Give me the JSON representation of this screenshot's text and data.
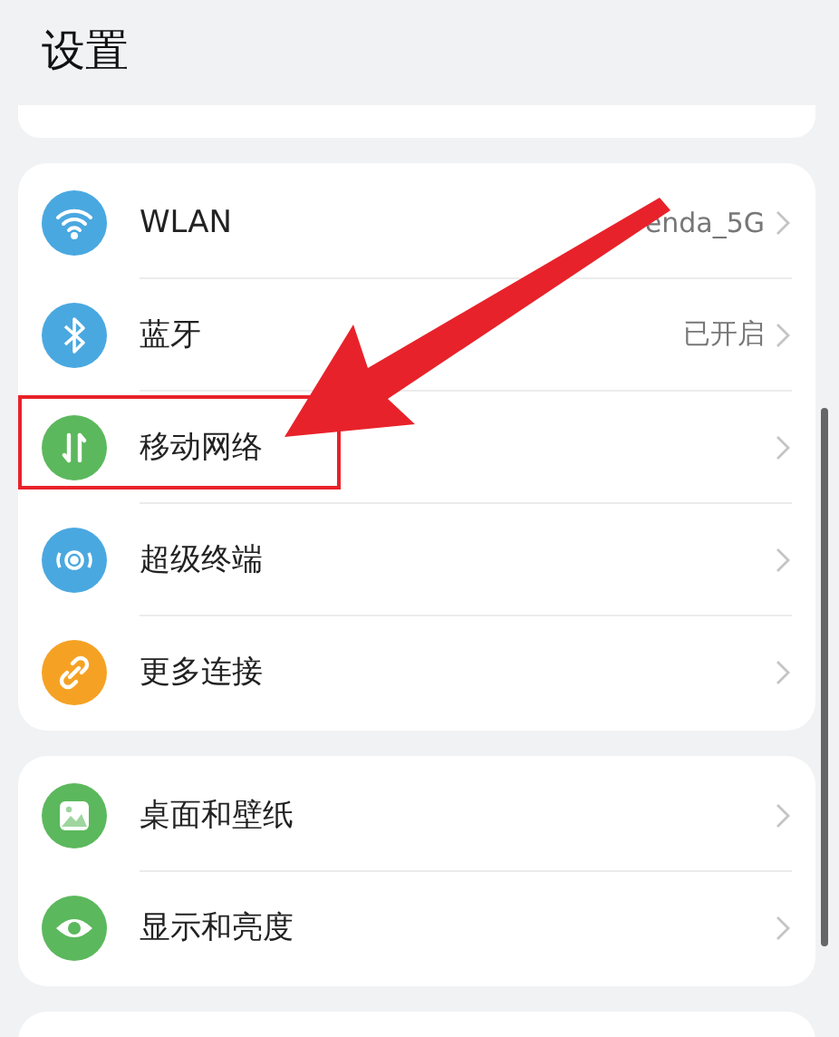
{
  "title": "设置",
  "search": {
    "kind": "partial"
  },
  "groups": [
    {
      "items": [
        {
          "kind": "wifi",
          "color": "#4aa8e0",
          "label": "WLAN",
          "value": "enda_5G",
          "highlighted": false
        },
        {
          "kind": "bluetooth",
          "color": "#4aa8e0",
          "label": "蓝牙",
          "value": "已开启",
          "highlighted": false
        },
        {
          "kind": "data",
          "color": "#5cb85c",
          "label": "移动网络",
          "highlighted": true
        },
        {
          "kind": "terminal",
          "color": "#4aa8e0",
          "label": "超级终端",
          "highlighted": false
        },
        {
          "kind": "link",
          "color": "#f5a224",
          "label": "更多连接",
          "highlighted": false
        }
      ]
    },
    {
      "items": [
        {
          "kind": "wallpaper",
          "color": "#5cb85c",
          "label": "桌面和壁纸",
          "highlighted": false
        },
        {
          "kind": "eye",
          "color": "#5cb85c",
          "label": "显示和亮度",
          "highlighted": false
        }
      ]
    }
  ],
  "annotation": {
    "arrow": true
  }
}
